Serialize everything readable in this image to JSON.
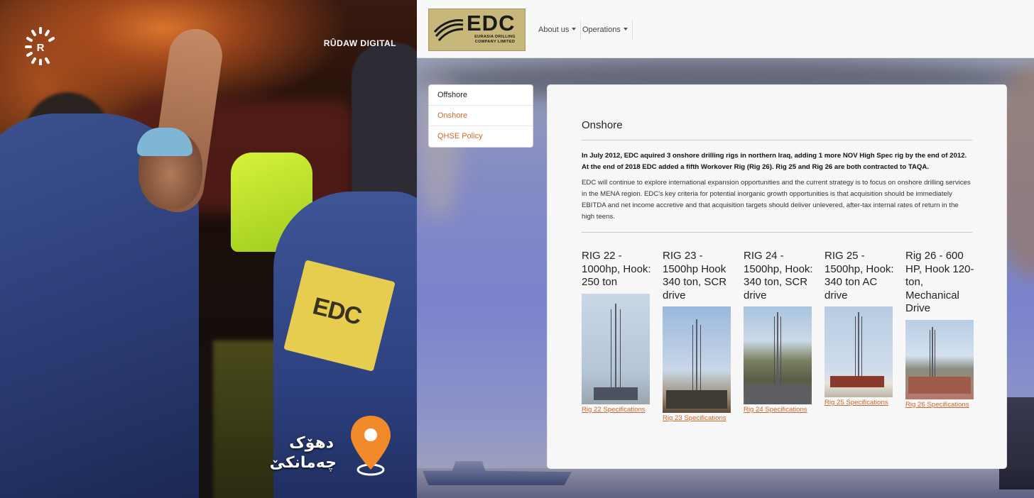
{
  "video": {
    "brand": "RÛDAW DIGITAL",
    "logo_letter": "R",
    "jacket_badge": "EDC",
    "location_line1": "دهۆک",
    "location_line2": "چەمانکێ"
  },
  "site": {
    "logo": {
      "big": "EDC",
      "small": "EURASIA DRILLING COMPANY LIMITED"
    },
    "nav": [
      {
        "label": "About us"
      },
      {
        "label": "Operations"
      }
    ],
    "sidebar": [
      {
        "label": "Offshore"
      },
      {
        "label": "Onshore"
      },
      {
        "label": "QHSE Policy"
      }
    ],
    "content": {
      "title": "Onshore",
      "lead": "In July 2012, EDC aquired 3 onshore drilling rigs in northern Iraq, adding 1 more NOV High Spec rig by the end of 2012. At the end of 2018 EDC added a fifth Workover Rig (Rig 26). Rig 25 and Rig 26 are both contracted to TAQA.",
      "body": "EDC will continue to explore international expansion opportunities and the current strategy is to focus on onshore drilling services in the MENA region. EDC's key criteria for potential inorganic growth opportunities is that acquisition should be immediately EBITDA and net income accretive and that acquisition targets should deliver unlevered, after-tax internal rates of return in the high teens."
    },
    "rigs": [
      {
        "title": "RIG 22 - 1000hp, Hook: 250 ton",
        "link": "Rig 22 Specifications"
      },
      {
        "title": "RIG 23 - 1500hp Hook 340 ton, SCR drive",
        "link": "Rig 23 Specifications"
      },
      {
        "title": "RIG 24 - 1500hp, Hook: 340 ton, SCR drive",
        "link": "Rig 24 Specifications"
      },
      {
        "title": "RIG 25 - 1500hp, Hook: 340 ton AC drive",
        "link": "Rig 25 Specifications"
      },
      {
        "title": "Rig 26 - 600 HP, Hook 120-ton, Mechanical Drive",
        "link": "Rig 26 Specifications"
      }
    ]
  },
  "colors": {
    "accent": "#c9692f",
    "logo_bg": "#c7b77a"
  }
}
